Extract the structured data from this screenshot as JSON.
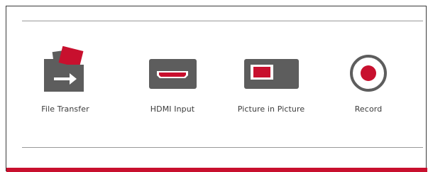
{
  "features": [
    {
      "label": "File Transfer",
      "icon": "file-transfer-icon"
    },
    {
      "label": "HDMI Input",
      "icon": "hdmi-input-icon"
    },
    {
      "label": "Picture in Picture",
      "icon": "picture-in-picture-icon"
    },
    {
      "label": "Record",
      "icon": "record-icon"
    }
  ],
  "colors": {
    "accent": "#c8102e",
    "icon_gray": "#5d5d5d",
    "text": "#3b3b3b",
    "rule": "#9a9a9a"
  }
}
